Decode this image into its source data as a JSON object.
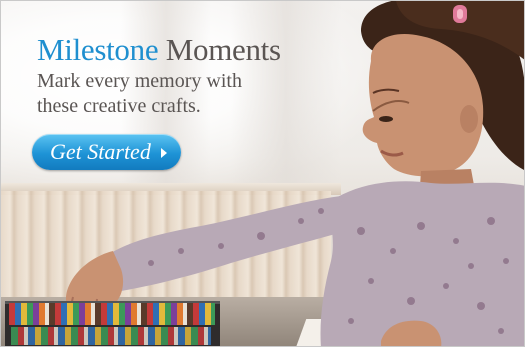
{
  "banner": {
    "headline_accent": "Milestone",
    "headline_rest": "Moments",
    "subhead_line1": "Mark every memory with",
    "subhead_line2": "these creative crafts.",
    "cta_label": "Get Started",
    "cta_icon": "triangle-right-icon"
  },
  "colors": {
    "accent": "#1f8fcf",
    "text": "#5a5553",
    "button": "#1e93d6"
  }
}
